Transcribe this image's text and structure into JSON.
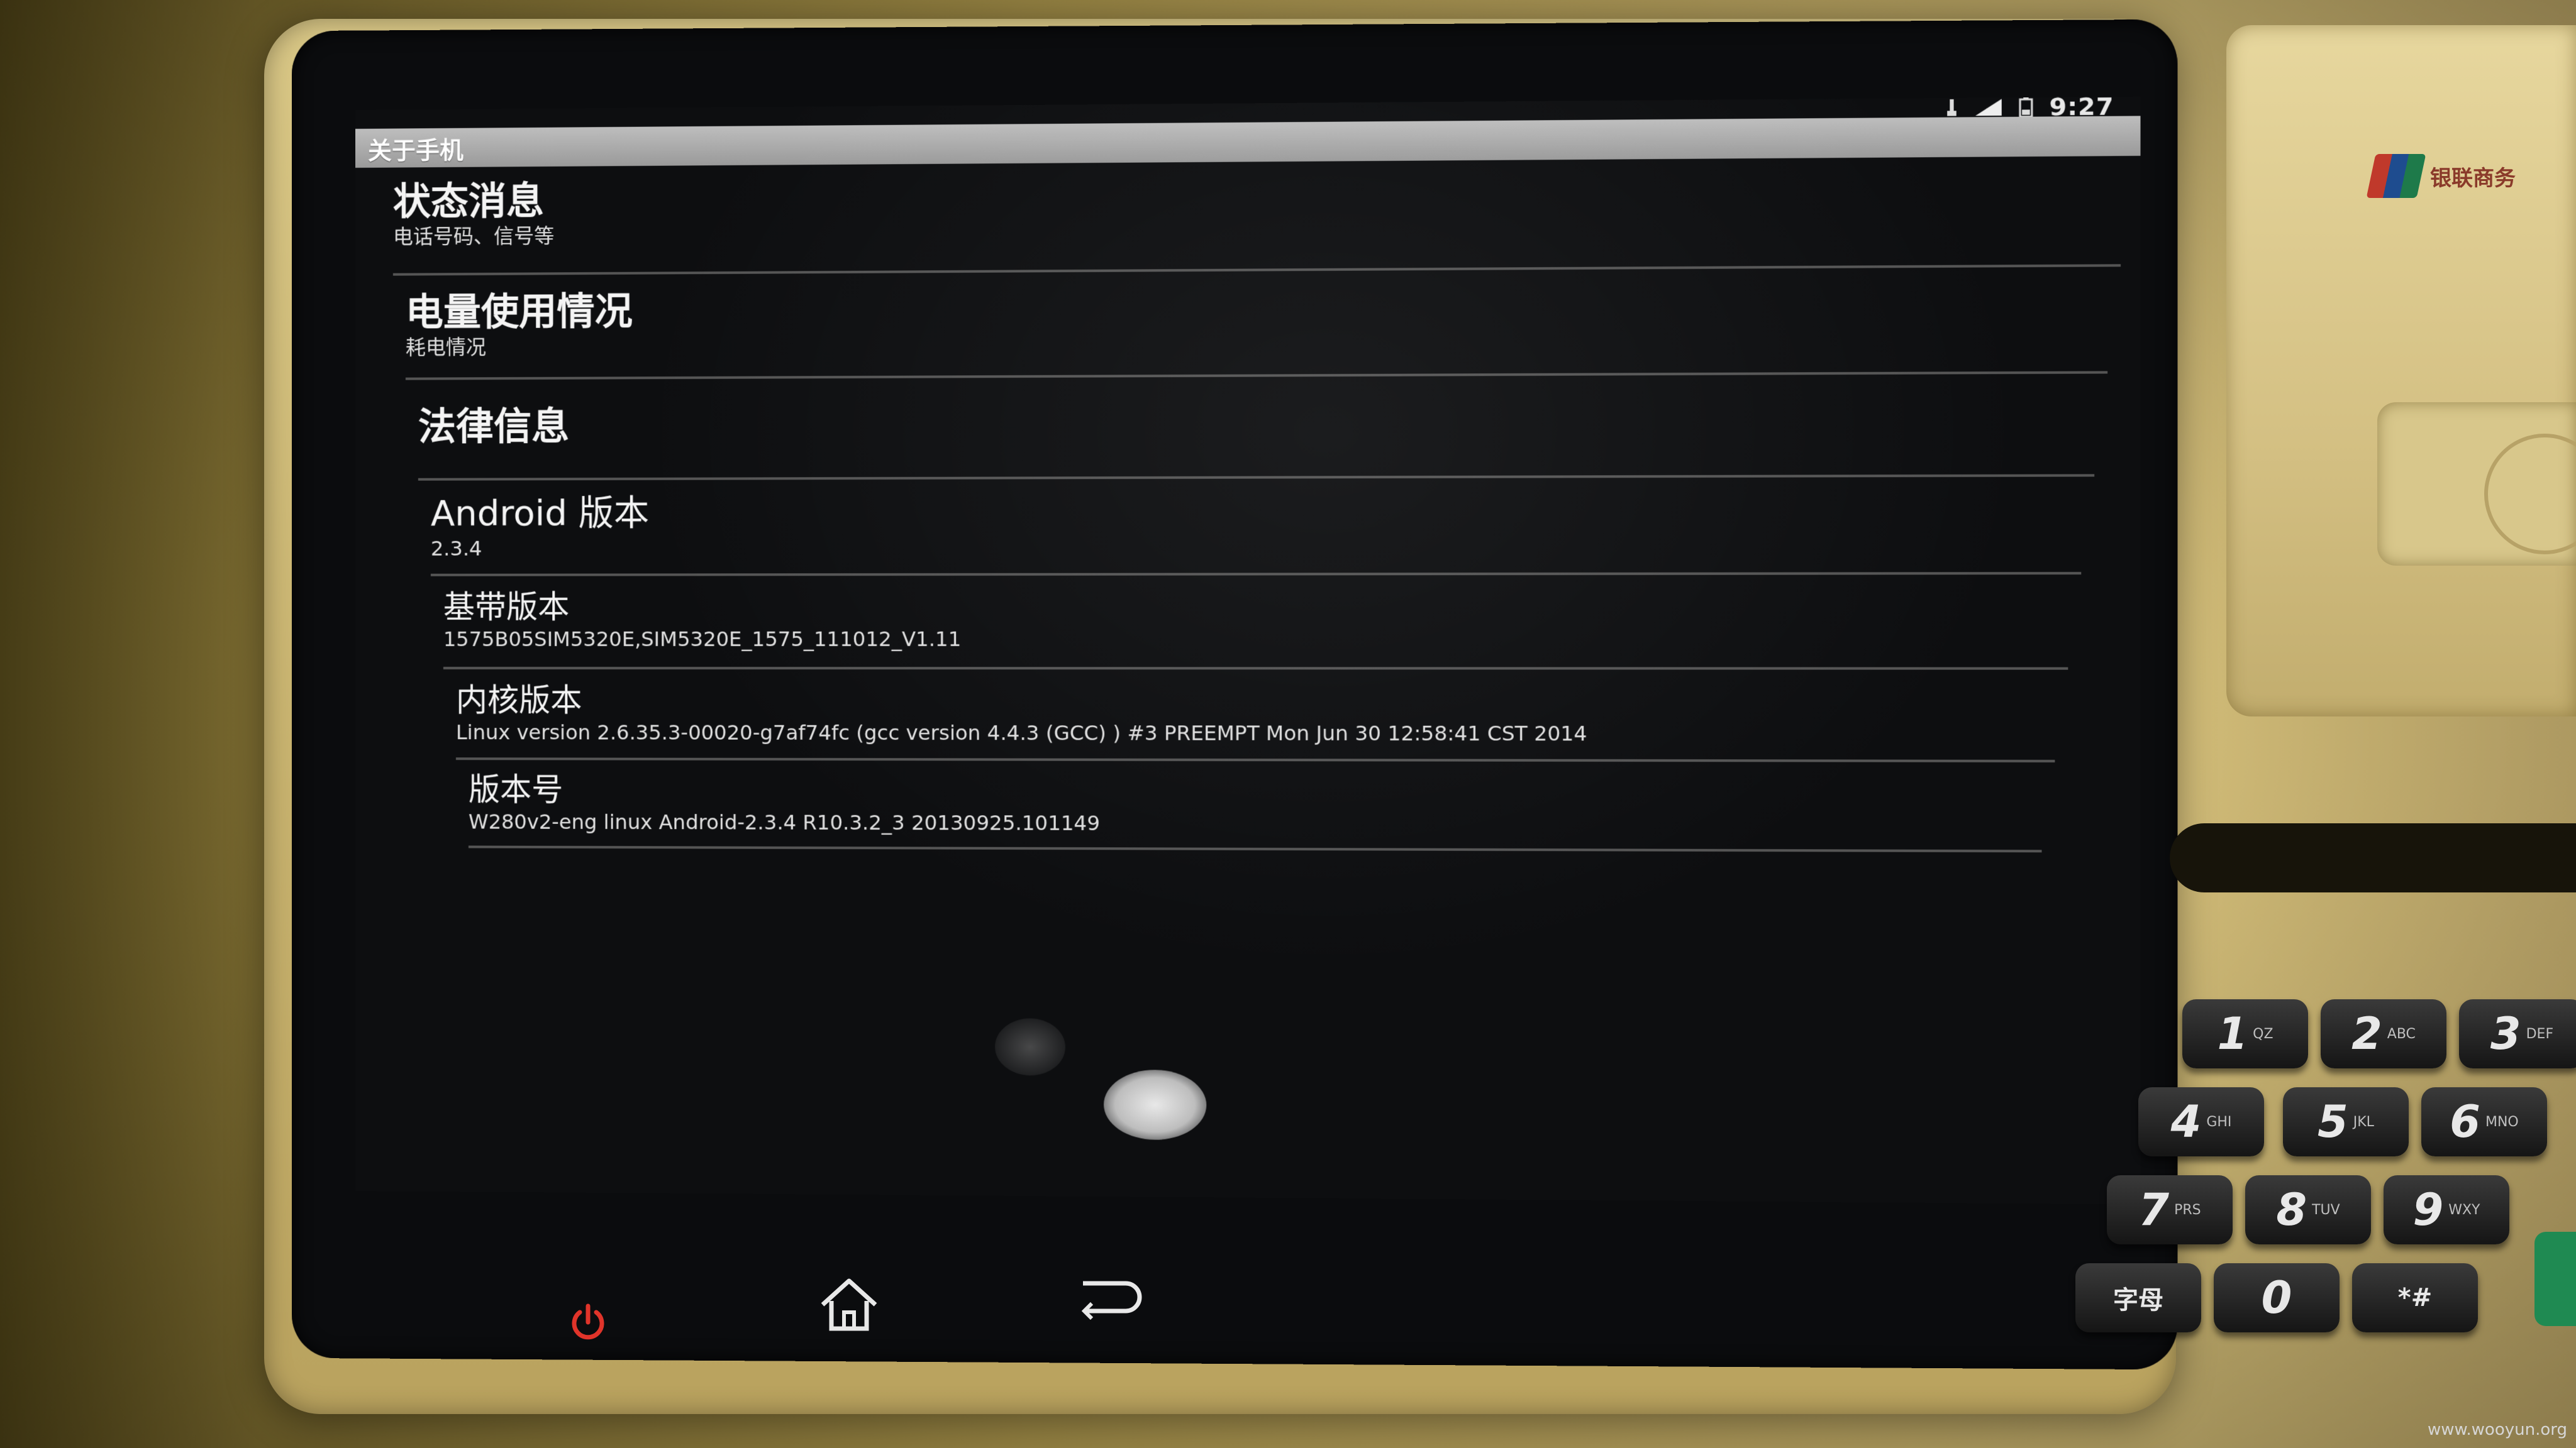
{
  "status_bar": {
    "time": "9:27"
  },
  "screen_title": "关于手机",
  "items": [
    {
      "title": "状态消息",
      "subtitle": "电话号码、信号等"
    },
    {
      "title": "电量使用情况",
      "subtitle": "耗电情况"
    },
    {
      "title": "法律信息",
      "subtitle": ""
    },
    {
      "title": "Android 版本",
      "subtitle": "2.3.4"
    },
    {
      "title": "基带版本",
      "subtitle": "1575B05SIM5320E,SIM5320E_1575_111012_V1.11"
    },
    {
      "title": "内核版本",
      "subtitle": "Linux version 2.6.35.3-00020-g7af74fc (gcc version 4.4.3 (GCC) ) #3 PREEMPT Mon Jun 30 12:58:41 CST 2014"
    },
    {
      "title": "版本号",
      "subtitle": "W280v2-eng linux Android-2.3.4 R10.3.2_3 20130925.101149"
    }
  ],
  "nav": {
    "power_icon": "power-icon",
    "home_icon": "home-icon",
    "back_icon": "back-icon"
  },
  "keypad": {
    "keys": [
      {
        "num": "1",
        "sub": "QZ"
      },
      {
        "num": "2",
        "sub": "ABC"
      },
      {
        "num": "3",
        "sub": "DEF"
      },
      {
        "num": "4",
        "sub": "GHI"
      },
      {
        "num": "5",
        "sub": "JKL"
      },
      {
        "num": "6",
        "sub": "MNO"
      },
      {
        "num": "7",
        "sub": "PRS"
      },
      {
        "num": "8",
        "sub": "TUV"
      },
      {
        "num": "9",
        "sub": "WXY"
      },
      {
        "label": "字母"
      },
      {
        "num": "0"
      },
      {
        "label": "*#"
      }
    ]
  },
  "logo_text": "银联商务",
  "watermark": "www.wooyun.org",
  "colors": {
    "title_bar": "#a8a8a8",
    "screen_bg": "#0d0e10",
    "bezel": "#c9b470"
  }
}
